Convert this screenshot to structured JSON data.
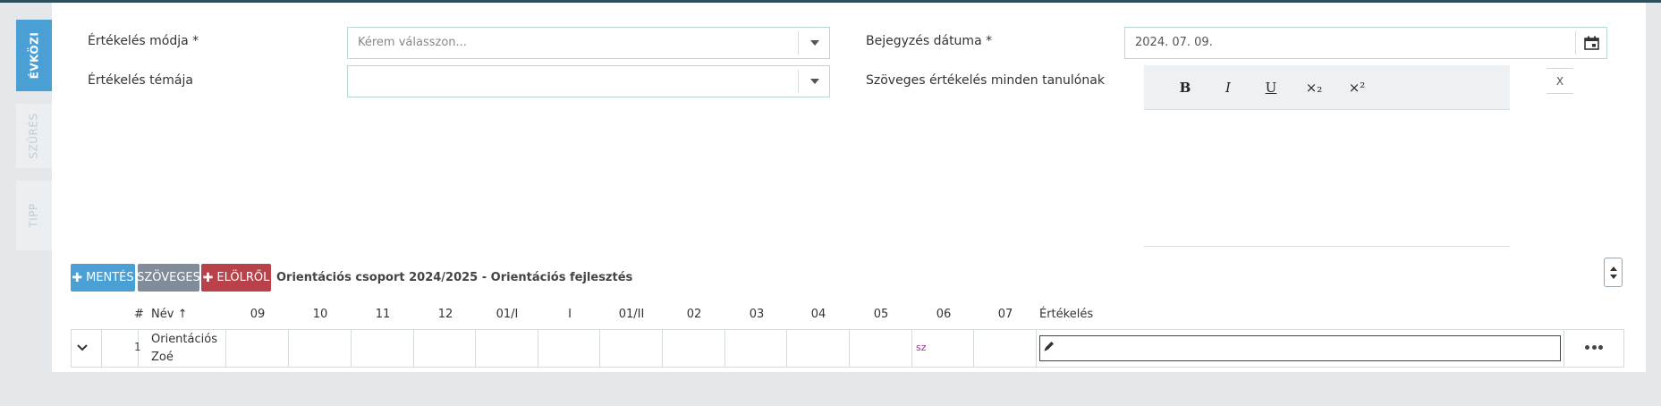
{
  "side_tabs": [
    {
      "label": "ÉVKÖZI",
      "active": true
    },
    {
      "label": "SZŰRÉS",
      "active": false
    },
    {
      "label": "TIPP",
      "active": false
    }
  ],
  "form": {
    "eval_mode_label": "Értékelés módja *",
    "eval_mode_placeholder": "Kérem válasszon...",
    "entry_date_label": "Bejegyzés dátuma *",
    "entry_date_value": "2024. 07. 09.",
    "eval_topic_label": "Értékelés témája",
    "eval_topic_value": "",
    "text_eval_label": "Szöveges értékelés minden tanulónak",
    "clear_label": "X"
  },
  "editor_toolbar": {
    "bold": "B",
    "italic": "I",
    "underline": "U",
    "subscript": "×₂",
    "superscript": "×²"
  },
  "actions": {
    "save": "MENTÉS",
    "text": "SZÖVEGES",
    "reset": "ELÖLRŐL"
  },
  "group_title": "Orientációs csoport 2024/2025 - Orientációs fejlesztés",
  "table": {
    "headers": [
      "#",
      "Név",
      "09",
      "10",
      "11",
      "12",
      "01/I",
      "I",
      "01/II",
      "02",
      "03",
      "04",
      "05",
      "06",
      "07",
      "Értékelés"
    ],
    "sort_indicator": "↑",
    "rows": [
      {
        "num": "1",
        "name_line1": "Orientációs",
        "name_line2": "Zoé",
        "marks": {
          "06": "sz"
        },
        "evaluation": ""
      }
    ]
  },
  "colors": {
    "accent": "#4a9fd4",
    "neutral_button": "#808c99",
    "danger": "#b8414a",
    "mark": "#a03090"
  }
}
